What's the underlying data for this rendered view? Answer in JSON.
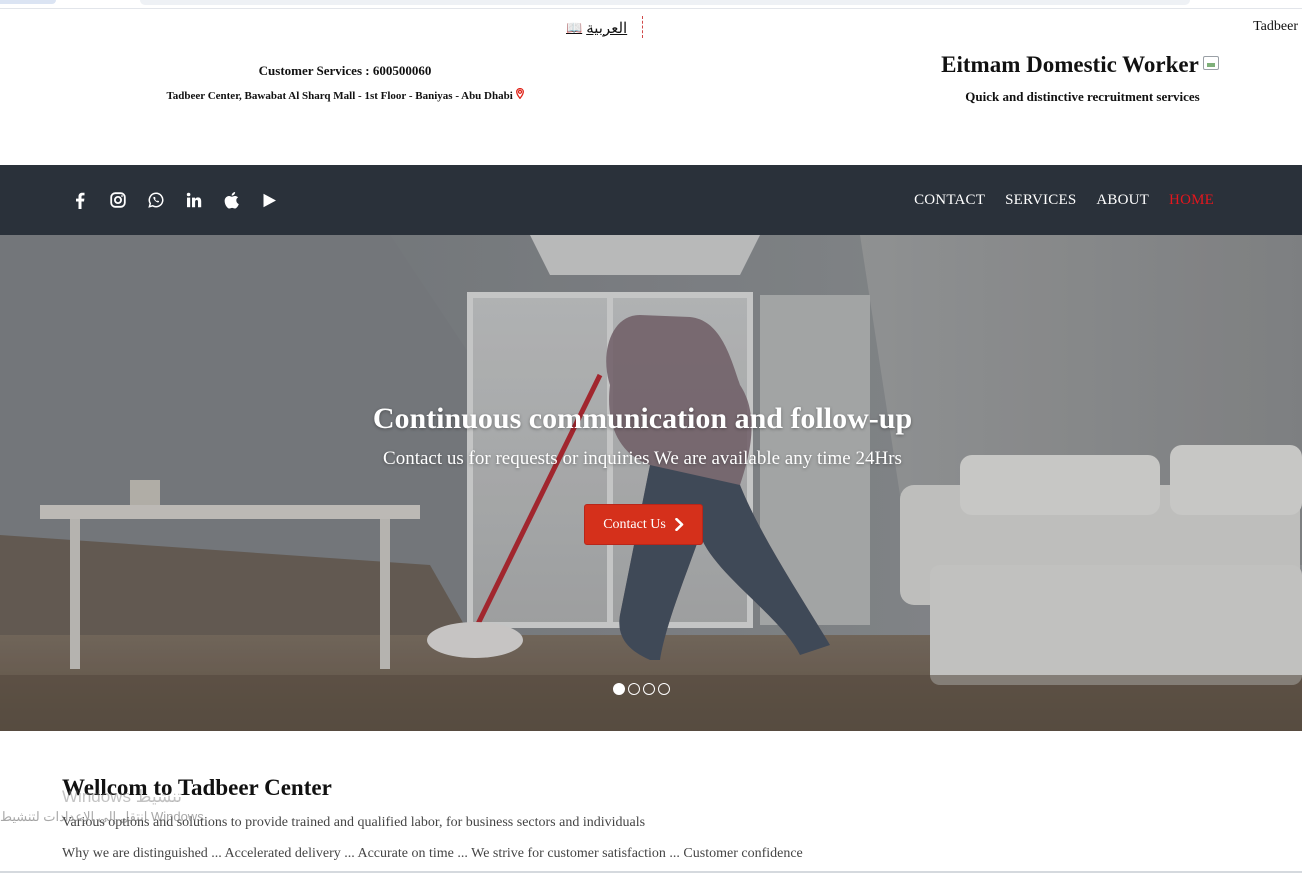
{
  "topbar": {
    "language_link": "العربية",
    "language_icon": "flag-book-icon",
    "tadbeer_label": "Tadbeer"
  },
  "header": {
    "customer_services": "Customer Services : 600500060",
    "address": "Tadbeer Center, Bawabat Al Sharq Mall - 1st Floor - Baniyas - Abu Dhabi",
    "address_icon": "map-pin-icon",
    "brand_title": "Eitmam Domestic Worker",
    "brand_tagline": "Quick and distinctive recruitment services"
  },
  "nav": {
    "social_icons": [
      "facebook-icon",
      "instagram-icon",
      "whatsapp-icon",
      "linkedin-icon",
      "apple-icon",
      "play-icon"
    ],
    "links": [
      "CONTACT",
      "SERVICES",
      "ABOUT",
      "HOME"
    ],
    "active_link": "HOME",
    "active_color": "#e4161d",
    "bar_color": "#2a313a"
  },
  "hero": {
    "title": "Continuous communication and follow-up",
    "subtitle": "Contact us for requests or inquiries We are available any time 24Hrs",
    "cta_label": "Contact Us",
    "cta_color": "#d5301b",
    "slides_total": 4,
    "active_slide": 1
  },
  "welcome": {
    "title": "Wellcom to Tadbeer Center",
    "paragraph_1": "Various options and solutions to provide trained and qualified labor, for business sectors and individuals",
    "paragraph_2": "Why we are distinguished ... Accelerated delivery ... Accurate on time ... We strive for customer satisfaction ... Customer confidence"
  },
  "watermark": {
    "line_1": "Windows تنشيط",
    "line_2": "انتقل إلى الإعدادات لتنشيط Windows"
  }
}
